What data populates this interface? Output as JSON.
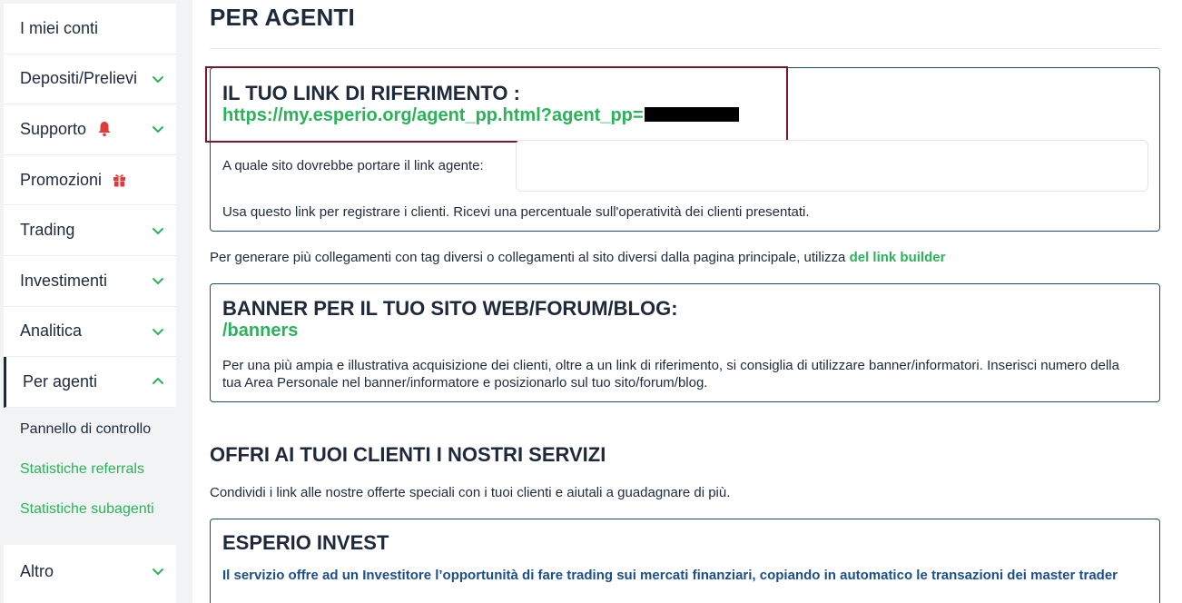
{
  "sidebar": {
    "items": [
      {
        "label": "I miei conti"
      },
      {
        "label": "Depositi/Prelievi"
      },
      {
        "label": "Supporto"
      },
      {
        "label": "Promozioni"
      },
      {
        "label": "Trading"
      },
      {
        "label": "Investimenti"
      },
      {
        "label": "Analitica"
      },
      {
        "label": "Per agenti"
      }
    ],
    "submenu": [
      {
        "label": "Pannello di controllo"
      },
      {
        "label": "Statistiche referrals"
      },
      {
        "label": "Statistiche subagenti"
      }
    ],
    "other": {
      "label": "Altro"
    }
  },
  "main": {
    "title": "PER AGENTI",
    "ref_card": {
      "title": "IL TUO LINK DI RIFERIMENTO :",
      "url": "https://my.esperio.org/agent_pp.html?agent_pp=",
      "site_label": "A quale sito dovrebbe portare il link agente:",
      "site_value": "",
      "help": "Usa questo link per registrare i clienti. Ricevi una percentuale sull'operatività dei clienti presentati."
    },
    "generate": {
      "text": "Per generare più collegamenti con tag diversi o collegamenti al sito diversi dalla pagina principale, utilizza ",
      "link": "del link builder"
    },
    "banner_card": {
      "title": "BANNER PER IL TUO SITO WEB/FORUM/BLOG:",
      "link": "/banners",
      "text": "Per una più ampia e illustrativa acquisizione dei clienti, oltre a un link di riferimento, si consiglia di utilizzare banner/informatori. Inserisci numero della tua Area Personale nel banner/informatore e posizionarlo sul tuo sito/forum/blog."
    },
    "offer": {
      "title": "OFFRI AI TUOI CLIENTI I NOSTRI SERVIZI",
      "subtitle": "Condividi i link alle nostre offerte speciali con i tuoi clienti e aiutali a guadagnare di più."
    },
    "invest_card": {
      "title": "ESPERIO INVEST",
      "text": "Il servizio offre ad un Investitore l’opportunità di fare trading sui mercati finanziari, copiando in automatico le transazioni dei master trader"
    }
  },
  "colors": {
    "accent_green": "#2bb35a",
    "text_dark": "#1e2a3b",
    "card_border": "#1b4f6f",
    "highlight_border": "#7a1828",
    "bell_red": "#e03b3b"
  },
  "icons": {
    "chevron": "chevron-down-icon",
    "chevron_up": "chevron-up-icon",
    "bell": "bell-icon",
    "gift": "gift-icon"
  }
}
